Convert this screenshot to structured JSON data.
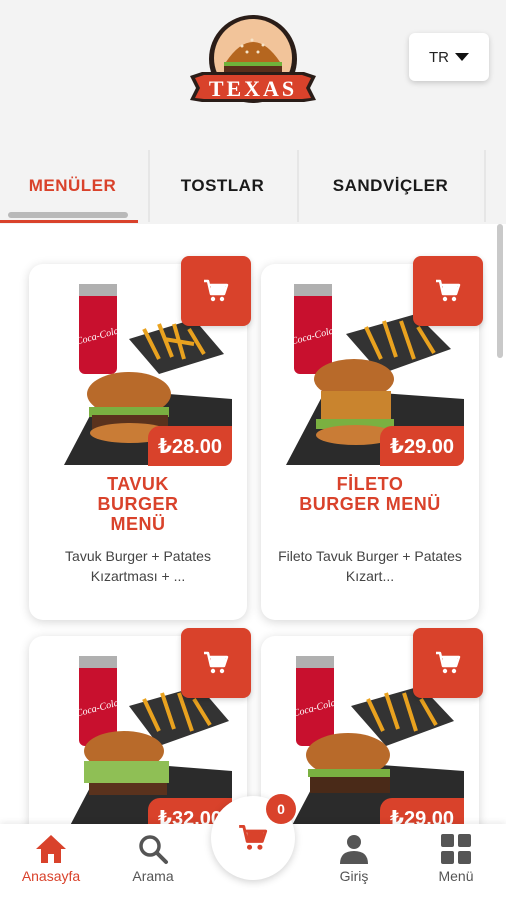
{
  "brand": {
    "logo_text": "TEXAS",
    "accent": "#d9422b"
  },
  "language": {
    "label": "TR",
    "icon": "caret-down-icon"
  },
  "tabs": [
    {
      "label": "MENÜLER",
      "active": true
    },
    {
      "label": "TOSTLAR",
      "active": false
    },
    {
      "label": "SANDVİÇLER",
      "active": false
    }
  ],
  "products": [
    {
      "title": "TAVUK BURGER MENÜ",
      "price": "₺28.00",
      "description": "Tavuk Burger + Patates Kızartması + ..."
    },
    {
      "title": "FİLETO BURGER MENÜ",
      "price": "₺29.00",
      "description": "Fileto Tavuk Burger + Patates Kızart..."
    },
    {
      "title": "",
      "price": "₺32.00",
      "description": ""
    },
    {
      "title": "",
      "price": "₺29.00",
      "description": ""
    }
  ],
  "cart": {
    "count": "0",
    "icon": "cart-icon"
  },
  "nav": [
    {
      "label": "Anasayfa",
      "icon": "home-icon",
      "active": true
    },
    {
      "label": "Arama",
      "icon": "search-icon",
      "active": false
    },
    {
      "label": "Giriş",
      "icon": "user-icon",
      "active": false
    },
    {
      "label": "Menü",
      "icon": "grid-icon",
      "active": false
    }
  ]
}
